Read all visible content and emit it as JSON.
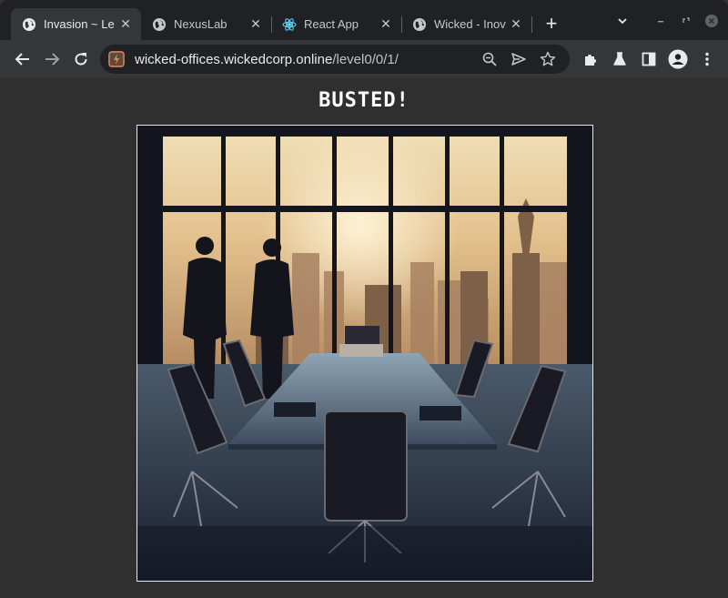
{
  "tabs": [
    {
      "title": "Invasion ~ Le",
      "icon": "globe-icon",
      "active": true
    },
    {
      "title": "NexusLab",
      "icon": "globe-icon",
      "active": false
    },
    {
      "title": "React App",
      "icon": "react-icon",
      "active": false
    },
    {
      "title": "Wicked - Inov",
      "icon": "globe-icon",
      "active": false
    }
  ],
  "address_bar": {
    "host": "wicked-offices.wickedcorp.online",
    "path": "/level0/0/1/"
  },
  "page": {
    "heading": "BUSTED!"
  },
  "colors": {
    "tab_strip": "#202124",
    "toolbar": "#35363a",
    "page_background": "#2f2f2f",
    "heading_text": "#ffffff"
  }
}
